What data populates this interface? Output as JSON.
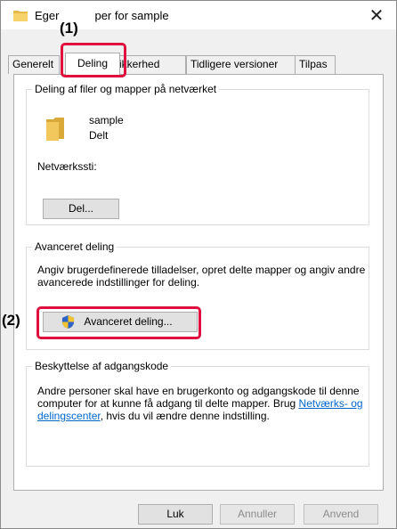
{
  "window": {
    "title": "Egenskaber for sample",
    "title_prefix": "Eger",
    "title_suffix": "per for sample",
    "close_symbol": "✕"
  },
  "tabs": [
    {
      "label": "Generelt",
      "active": false
    },
    {
      "label": "Deling",
      "active": true
    },
    {
      "label": "Sikkerhed",
      "active": false
    },
    {
      "label": "Tidligere versioner",
      "active": false
    },
    {
      "label": "Tilpas",
      "active": false
    }
  ],
  "sharing": {
    "legend": "Deling af filer og mapper på netværket",
    "folder_name": "sample",
    "folder_status": "Delt",
    "network_path_label": "Netværkssti:",
    "share_button": "Del..."
  },
  "advanced": {
    "legend": "Avanceret deling",
    "description": "Angiv brugerdefinerede tilladelser, opret delte mapper og angiv andre avancerede indstillinger for deling.",
    "button": "Avanceret deling..."
  },
  "password": {
    "legend": "Beskyttelse af adgangskode",
    "text_before": "Andre personer skal have en brugerkonto og adgangskode til denne computer for at kunne få adgang til delte mapper. Brug",
    "link": "Netværks- og delingscenter",
    "text_after": ", hvis du vil ændre denne indstilling."
  },
  "footer": {
    "ok": "Luk",
    "cancel": "Annuller",
    "apply": "Anvend"
  },
  "callouts": {
    "one": "(1)",
    "two": "(2)"
  },
  "colors": {
    "highlight": "#e0103e",
    "link": "#0066cc",
    "folder": "#e8b84a"
  },
  "icons": {
    "title": "folder-icon",
    "close": "close-icon",
    "folder": "folder-icon",
    "shield": "uac-shield-icon"
  }
}
